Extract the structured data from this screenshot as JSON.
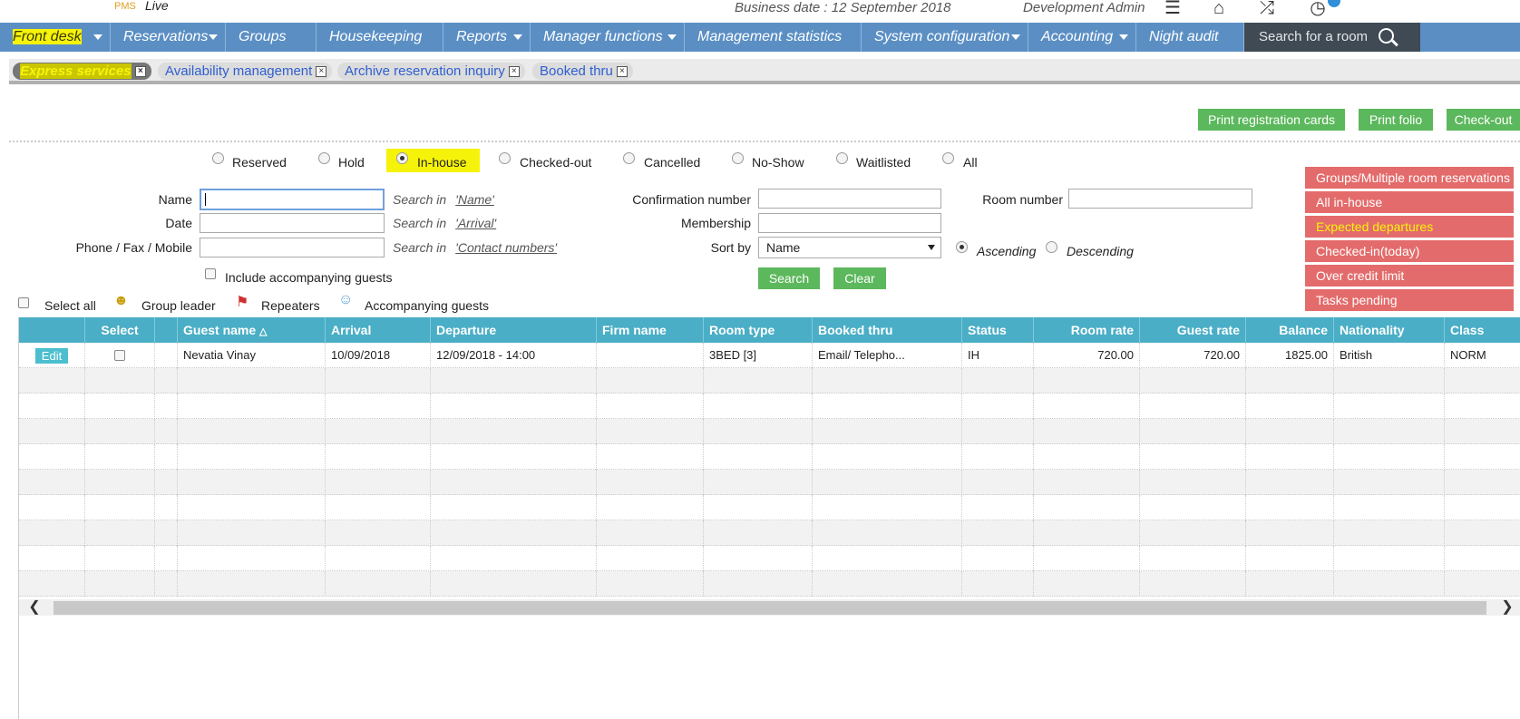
{
  "header": {
    "brand_pms": "PMS",
    "brand_live": "Live",
    "business_date": "Business date : 12 September 2018",
    "user": "Development Admin",
    "icons": [
      "menu-icon",
      "home-icon",
      "shuffle-icon",
      "clock-icon"
    ]
  },
  "nav": {
    "items": [
      {
        "label": "Front desk",
        "caret": true,
        "active": true
      },
      {
        "label": "Reservations",
        "caret": true
      },
      {
        "label": "Groups",
        "caret": false
      },
      {
        "label": "Housekeeping",
        "caret": false
      },
      {
        "label": "Reports",
        "caret": true
      },
      {
        "label": "Manager functions",
        "caret": true
      },
      {
        "label": "Management statistics",
        "caret": false
      },
      {
        "label": "System configuration",
        "caret": true
      },
      {
        "label": "Accounting",
        "caret": true
      },
      {
        "label": "Night audit",
        "caret": false
      }
    ],
    "search_placeholder": "Search for a room"
  },
  "tabs": [
    {
      "label": "Express services",
      "active": true
    },
    {
      "label": "Availability management"
    },
    {
      "label": "Archive reservation inquiry"
    },
    {
      "label": "Booked thru"
    }
  ],
  "actions": {
    "print_registration": "Print registration cards",
    "print_folio": "Print folio",
    "checkout": "Check-out"
  },
  "status_filters": {
    "options": [
      "Reserved",
      "Hold",
      "In-house",
      "Checked-out",
      "Cancelled",
      "No-Show",
      "Waitlisted",
      "All"
    ],
    "selected": "In-house"
  },
  "search_form": {
    "name_label": "Name",
    "date_label": "Date",
    "phone_label": "Phone / Fax / Mobile",
    "search_in": "Search in",
    "name_hint": "'Name'",
    "date_hint": "'Arrival'",
    "phone_hint": "'Contact numbers'",
    "include_accompanying": "Include accompanying guests",
    "confirmation_label": "Confirmation number",
    "membership_label": "Membership",
    "sort_label": "Sort by",
    "sort_value": "Name",
    "room_number_label": "Room number",
    "ascending": "Ascending",
    "descending": "Descending",
    "search_button": "Search",
    "clear_button": "Clear"
  },
  "quick_links": [
    "Groups/Multiple room reservations",
    "All in-house",
    "Expected departures",
    "Checked-in(today)",
    "Over credit limit",
    "Tasks pending"
  ],
  "legend": {
    "select_all": "Select all",
    "group_leader": "Group leader",
    "repeaters": "Repeaters",
    "accompanying": "Accompanying guests"
  },
  "table": {
    "columns": [
      "",
      "Select",
      "",
      "Guest name",
      "Arrival",
      "Departure",
      "Firm name",
      "Room type",
      "Booked thru",
      "Status",
      "Room rate",
      "Guest rate",
      "Balance",
      "Nationality",
      "Class"
    ],
    "edit_label": "Edit",
    "rows": [
      [
        "Nevatia Vinay",
        "10/09/2018",
        "12/09/2018 - 14:00",
        "",
        "3BED [3]",
        "Email/ Telepho...",
        "IH",
        "720.00",
        "720.00",
        "1825.00",
        "British",
        "NORM"
      ]
    ]
  }
}
